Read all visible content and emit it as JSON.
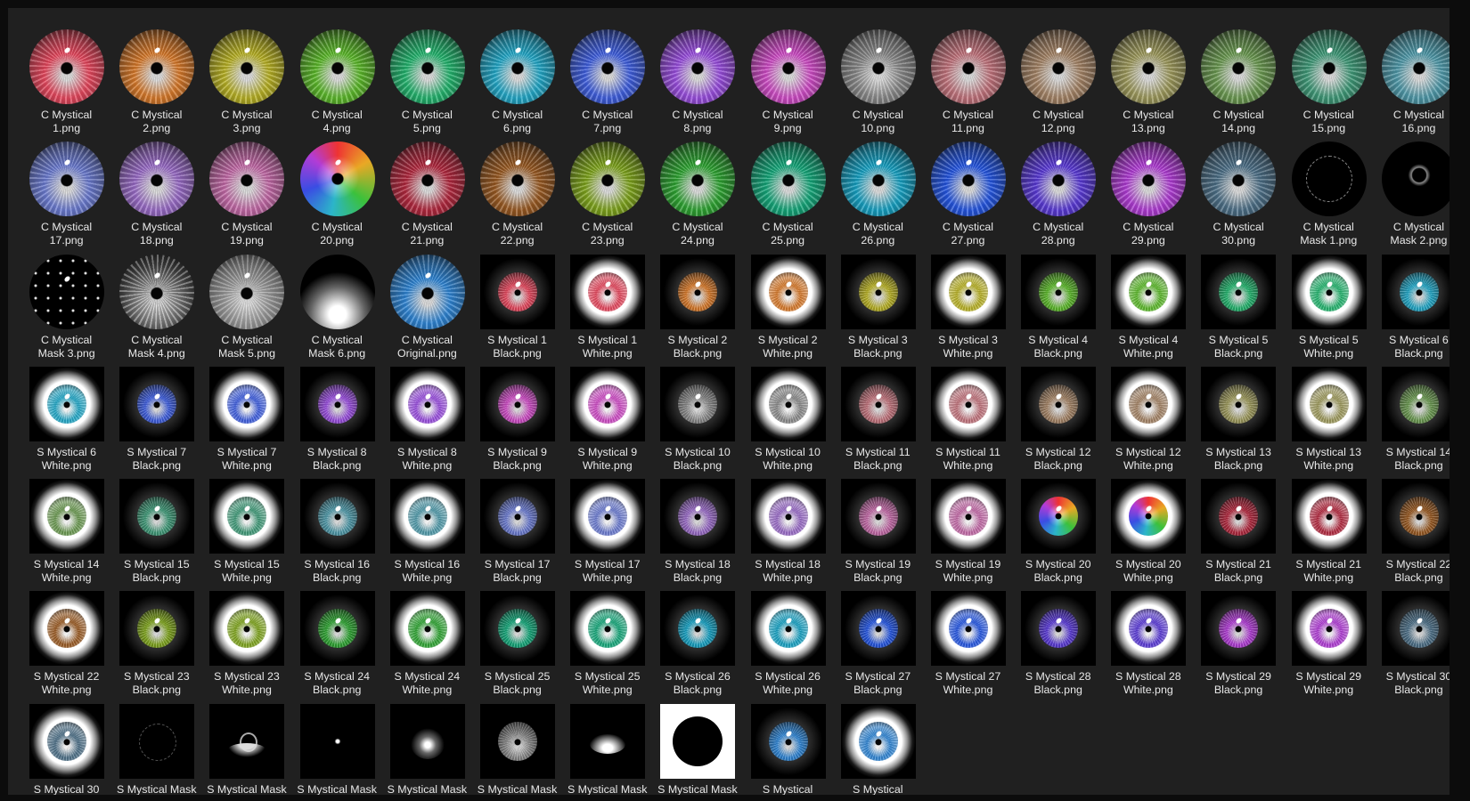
{
  "files": [
    {
      "label": "C Mystical\n1.png",
      "kind": "c",
      "color": "#e8485e"
    },
    {
      "label": "C Mystical\n2.png",
      "kind": "c",
      "color": "#d97a2a"
    },
    {
      "label": "C Mystical\n3.png",
      "kind": "c",
      "color": "#b9b224"
    },
    {
      "label": "C Mystical\n4.png",
      "kind": "c",
      "color": "#5cba2a"
    },
    {
      "label": "C Mystical\n5.png",
      "kind": "c",
      "color": "#23b56e"
    },
    {
      "label": "C Mystical\n6.png",
      "kind": "c",
      "color": "#22a9c9"
    },
    {
      "label": "C Mystical\n7.png",
      "kind": "c",
      "color": "#3f5fe0"
    },
    {
      "label": "C Mystical\n8.png",
      "kind": "c",
      "color": "#9a4ee0"
    },
    {
      "label": "C Mystical\n9.png",
      "kind": "c",
      "color": "#d04cc7"
    },
    {
      "label": "C Mystical\n10.png",
      "kind": "c",
      "color": "#8a8a8a"
    },
    {
      "label": "C Mystical\n11.png",
      "kind": "c",
      "color": "#c2737c"
    },
    {
      "label": "C Mystical\n12.png",
      "kind": "c",
      "color": "#a58466"
    },
    {
      "label": "C Mystical\n13.png",
      "kind": "c",
      "color": "#9e9a5c"
    },
    {
      "label": "C Mystical\n14.png",
      "kind": "c",
      "color": "#6b9a51"
    },
    {
      "label": "C Mystical\n15.png",
      "kind": "c",
      "color": "#3f9a78"
    },
    {
      "label": "C Mystical\n16.png",
      "kind": "c",
      "color": "#4f9aaa"
    },
    {
      "label": "C Mystical\n17.png",
      "kind": "c",
      "color": "#6c7cd2"
    },
    {
      "label": "C Mystical\n18.png",
      "kind": "c",
      "color": "#9a6cc8"
    },
    {
      "label": "C Mystical\n19.png",
      "kind": "c",
      "color": "#c46aa8"
    },
    {
      "label": "C Mystical\n20.png",
      "kind": "rainbow",
      "color": "#3aa55a"
    },
    {
      "label": "C Mystical\n21.png",
      "kind": "c",
      "color": "#b3283e"
    },
    {
      "label": "C Mystical\n22.png",
      "kind": "c",
      "color": "#9a5a22"
    },
    {
      "label": "C Mystical\n23.png",
      "kind": "c",
      "color": "#7fa51c"
    },
    {
      "label": "C Mystical\n24.png",
      "kind": "c",
      "color": "#2ea532"
    },
    {
      "label": "C Mystical\n25.png",
      "kind": "c",
      "color": "#14a87a"
    },
    {
      "label": "C Mystical\n26.png",
      "kind": "c",
      "color": "#16a2c4"
    },
    {
      "label": "C Mystical\n27.png",
      "kind": "c",
      "color": "#2456e3"
    },
    {
      "label": "C Mystical\n28.png",
      "kind": "c",
      "color": "#5a3ad8"
    },
    {
      "label": "C Mystical\n29.png",
      "kind": "c",
      "color": "#b13cd6"
    },
    {
      "label": "C Mystical\n30.png",
      "kind": "c",
      "color": "#4d7088"
    },
    {
      "label": "C Mystical\nMask 1.png",
      "kind": "mask-ring",
      "color": "#000000"
    },
    {
      "label": "C Mystical\nMask 2.png",
      "kind": "mask-dark",
      "color": "#000000"
    },
    {
      "label": "C Mystical\nMask 3.png",
      "kind": "mask-dots",
      "color": "#000000"
    },
    {
      "label": "C Mystical\nMask 4.png",
      "kind": "mask-gray",
      "color": "#777777"
    },
    {
      "label": "C Mystical\nMask 5.png",
      "kind": "c",
      "color": "#9c9c9c"
    },
    {
      "label": "C Mystical\nMask 6.png",
      "kind": "mask-fade",
      "color": "#b0b0b0"
    },
    {
      "label": "C Mystical\nOriginal.png",
      "kind": "c",
      "color": "#2f86d6"
    },
    {
      "label": "S Mystical 1\nBlack.png",
      "kind": "sb",
      "color": "#e8485e"
    },
    {
      "label": "S Mystical 1\nWhite.png",
      "kind": "sw",
      "color": "#e8485e"
    },
    {
      "label": "S Mystical 2\nBlack.png",
      "kind": "sb",
      "color": "#d97a2a"
    },
    {
      "label": "S Mystical 2\nWhite.png",
      "kind": "sw",
      "color": "#d97a2a"
    },
    {
      "label": "S Mystical 3\nBlack.png",
      "kind": "sb",
      "color": "#b9b224"
    },
    {
      "label": "S Mystical 3\nWhite.png",
      "kind": "sw",
      "color": "#b9b224"
    },
    {
      "label": "S Mystical 4\nBlack.png",
      "kind": "sb",
      "color": "#5cba2a"
    },
    {
      "label": "S Mystical 4\nWhite.png",
      "kind": "sw",
      "color": "#5cba2a"
    },
    {
      "label": "S Mystical 5\nBlack.png",
      "kind": "sb",
      "color": "#23b56e"
    },
    {
      "label": "S Mystical 5\nWhite.png",
      "kind": "sw",
      "color": "#23b56e"
    },
    {
      "label": "S Mystical 6\nBlack.png",
      "kind": "sb",
      "color": "#22a9c9"
    },
    {
      "label": "S Mystical 6\nWhite.png",
      "kind": "sw",
      "color": "#22a9c9"
    },
    {
      "label": "S Mystical 7\nBlack.png",
      "kind": "sb",
      "color": "#3f5fe0"
    },
    {
      "label": "S Mystical 7\nWhite.png",
      "kind": "sw",
      "color": "#3f5fe0"
    },
    {
      "label": "S Mystical 8\nBlack.png",
      "kind": "sb",
      "color": "#9a4ee0"
    },
    {
      "label": "S Mystical 8\nWhite.png",
      "kind": "sw",
      "color": "#9a4ee0"
    },
    {
      "label": "S Mystical 9\nBlack.png",
      "kind": "sb",
      "color": "#d04cc7"
    },
    {
      "label": "S Mystical 9\nWhite.png",
      "kind": "sw",
      "color": "#d04cc7"
    },
    {
      "label": "S Mystical 10\nBlack.png",
      "kind": "sb",
      "color": "#8a8a8a"
    },
    {
      "label": "S Mystical 10\nWhite.png",
      "kind": "sw",
      "color": "#8a8a8a"
    },
    {
      "label": "S Mystical 11\nBlack.png",
      "kind": "sb",
      "color": "#c2737c"
    },
    {
      "label": "S Mystical 11\nWhite.png",
      "kind": "sw",
      "color": "#c2737c"
    },
    {
      "label": "S Mystical 12\nBlack.png",
      "kind": "sb",
      "color": "#a58466"
    },
    {
      "label": "S Mystical 12\nWhite.png",
      "kind": "sw",
      "color": "#a58466"
    },
    {
      "label": "S Mystical 13\nBlack.png",
      "kind": "sb",
      "color": "#9e9a5c"
    },
    {
      "label": "S Mystical 13\nWhite.png",
      "kind": "sw",
      "color": "#9e9a5c"
    },
    {
      "label": "S Mystical 14\nBlack.png",
      "kind": "sb",
      "color": "#6b9a51"
    },
    {
      "label": "S Mystical 14\nWhite.png",
      "kind": "sw",
      "color": "#6b9a51"
    },
    {
      "label": "S Mystical 15\nBlack.png",
      "kind": "sb",
      "color": "#3f9a78"
    },
    {
      "label": "S Mystical 15\nWhite.png",
      "kind": "sw",
      "color": "#3f9a78"
    },
    {
      "label": "S Mystical 16\nBlack.png",
      "kind": "sb",
      "color": "#4f9aaa"
    },
    {
      "label": "S Mystical 16\nWhite.png",
      "kind": "sw",
      "color": "#4f9aaa"
    },
    {
      "label": "S Mystical 17\nBlack.png",
      "kind": "sb",
      "color": "#6c7cd2"
    },
    {
      "label": "S Mystical 17\nWhite.png",
      "kind": "sw",
      "color": "#6c7cd2"
    },
    {
      "label": "S Mystical 18\nBlack.png",
      "kind": "sb",
      "color": "#9a6cc8"
    },
    {
      "label": "S Mystical 18\nWhite.png",
      "kind": "sw",
      "color": "#9a6cc8"
    },
    {
      "label": "S Mystical 19\nBlack.png",
      "kind": "sb",
      "color": "#c46aa8"
    },
    {
      "label": "S Mystical 19\nWhite.png",
      "kind": "sw",
      "color": "#c46aa8"
    },
    {
      "label": "S Mystical 20\nBlack.png",
      "kind": "sb-rainbow",
      "color": "#3aa55a"
    },
    {
      "label": "S Mystical 20\nWhite.png",
      "kind": "sw-rainbow",
      "color": "#3aa55a"
    },
    {
      "label": "S Mystical 21\nBlack.png",
      "kind": "sb",
      "color": "#b3283e"
    },
    {
      "label": "S Mystical 21\nWhite.png",
      "kind": "sw",
      "color": "#b3283e"
    },
    {
      "label": "S Mystical 22\nBlack.png",
      "kind": "sb",
      "color": "#9a5a22"
    },
    {
      "label": "S Mystical 22\nWhite.png",
      "kind": "sw",
      "color": "#9a5a22"
    },
    {
      "label": "S Mystical 23\nBlack.png",
      "kind": "sb",
      "color": "#7fa51c"
    },
    {
      "label": "S Mystical 23\nWhite.png",
      "kind": "sw",
      "color": "#7fa51c"
    },
    {
      "label": "S Mystical 24\nBlack.png",
      "kind": "sb",
      "color": "#2ea532"
    },
    {
      "label": "S Mystical 24\nWhite.png",
      "kind": "sw",
      "color": "#2ea532"
    },
    {
      "label": "S Mystical 25\nBlack.png",
      "kind": "sb",
      "color": "#14a87a"
    },
    {
      "label": "S Mystical 25\nWhite.png",
      "kind": "sw",
      "color": "#14a87a"
    },
    {
      "label": "S Mystical 26\nBlack.png",
      "kind": "sb",
      "color": "#16a2c4"
    },
    {
      "label": "S Mystical 26\nWhite.png",
      "kind": "sw",
      "color": "#16a2c4"
    },
    {
      "label": "S Mystical 27\nBlack.png",
      "kind": "sb",
      "color": "#2456e3"
    },
    {
      "label": "S Mystical 27\nWhite.png",
      "kind": "sw",
      "color": "#2456e3"
    },
    {
      "label": "S Mystical 28\nBlack.png",
      "kind": "sb",
      "color": "#5a3ad8"
    },
    {
      "label": "S Mystical 28\nWhite.png",
      "kind": "sw",
      "color": "#5a3ad8"
    },
    {
      "label": "S Mystical 29\nBlack.png",
      "kind": "sb",
      "color": "#b13cd6"
    },
    {
      "label": "S Mystical 29\nWhite.png",
      "kind": "sw",
      "color": "#b13cd6"
    },
    {
      "label": "S Mystical 30\nBlack.png",
      "kind": "sb",
      "color": "#4d7088"
    },
    {
      "label": "S Mystical 30",
      "kind": "sw",
      "color": "#4d7088"
    },
    {
      "label": "S Mystical Mask",
      "kind": "smask-ring",
      "color": "#000000"
    },
    {
      "label": "S Mystical Mask",
      "kind": "smask-crown",
      "color": "#000000"
    },
    {
      "label": "S Mystical Mask",
      "kind": "smask-dots",
      "color": "#000000"
    },
    {
      "label": "S Mystical Mask",
      "kind": "smask-spark",
      "color": "#000000"
    },
    {
      "label": "S Mystical Mask",
      "kind": "smask-gray",
      "color": "#8a8a8a"
    },
    {
      "label": "S Mystical Mask",
      "kind": "smask-fade",
      "color": "#b0b0b0"
    },
    {
      "label": "S Mystical Mask",
      "kind": "smask-dot",
      "color": "#000000"
    },
    {
      "label": "S Mystical",
      "kind": "sb",
      "color": "#2f86d6"
    },
    {
      "label": "S Mystical",
      "kind": "sw",
      "color": "#2f86d6"
    }
  ]
}
